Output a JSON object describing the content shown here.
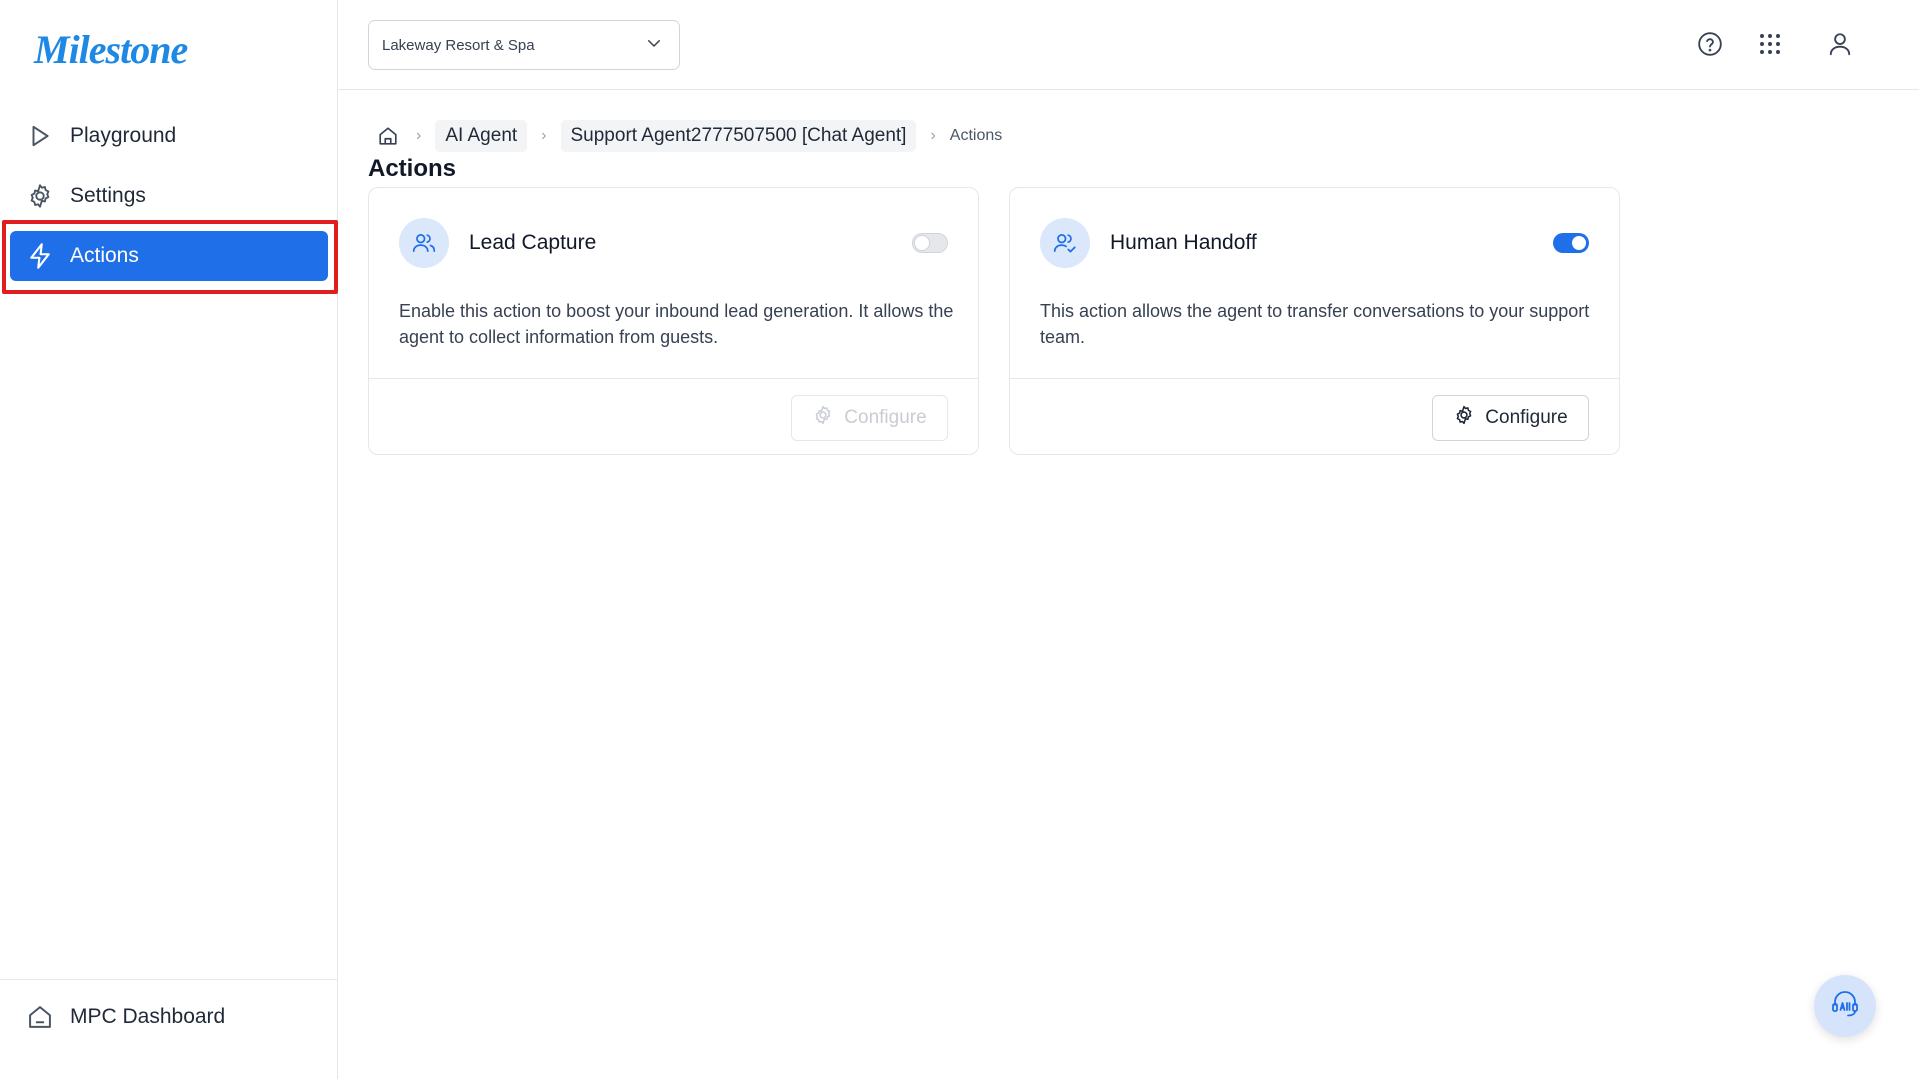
{
  "brand": {
    "name": "Milestone"
  },
  "sidebar": {
    "items": [
      {
        "label": "Playground",
        "icon": "play-icon"
      },
      {
        "label": "Settings",
        "icon": "gear-icon"
      },
      {
        "label": "Actions",
        "icon": "lightning-icon",
        "active": true
      }
    ],
    "bottom": {
      "label": "MPC Dashboard",
      "icon": "home-icon"
    }
  },
  "topbar": {
    "property": "Lakeway Resort & Spa",
    "icons": [
      "help-icon",
      "apps-grid-icon",
      "user-icon"
    ]
  },
  "breadcrumb": {
    "items": [
      "AI Agent",
      "Support Agent2777507500 [Chat Agent]"
    ],
    "current": "Actions"
  },
  "page": {
    "title": "Actions"
  },
  "cards": [
    {
      "title": "Lead Capture",
      "description": "Enable this action to boost your inbound lead generation. It allows the agent to collect information from guests.",
      "enabled": false,
      "configure_label": "Configure"
    },
    {
      "title": "Human Handoff",
      "description": "This action allows the agent to transfer conversations to your support team.",
      "enabled": true,
      "configure_label": "Configure"
    }
  ],
  "colors": {
    "accent": "#1f6fe8",
    "highlight": "#e01e1e",
    "brand": "#1e88e5"
  }
}
